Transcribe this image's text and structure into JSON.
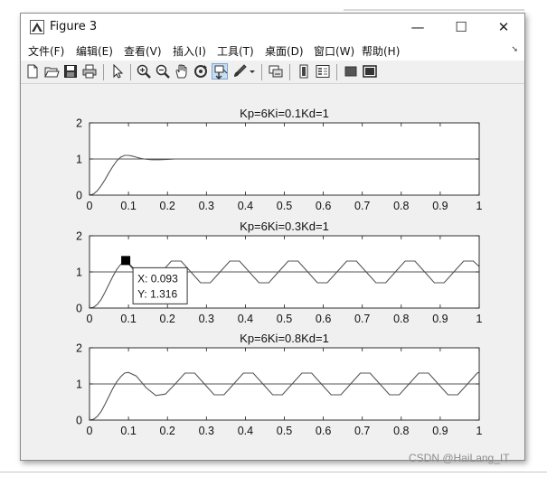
{
  "window": {
    "title": "Figure 3",
    "controls": {
      "minimize": "—",
      "maximize": "☐",
      "close": "✕"
    }
  },
  "menu": [
    "文件(F)",
    "编辑(E)",
    "查看(V)",
    "插入(I)",
    "工具(T)",
    "桌面(D)",
    "窗口(W)",
    "帮助(H)"
  ],
  "toolbar": [
    "new-figure-icon",
    "open-icon",
    "save-icon",
    "print-icon",
    "pointer-icon",
    "zoom-in-icon",
    "zoom-out-icon",
    "pan-icon",
    "rotate-icon",
    "data-cursor-icon",
    "brush-icon",
    "link-plot-icon",
    "colorbar-icon",
    "legend-icon",
    "hide-tools-icon",
    "show-tools-icon"
  ],
  "colors": {
    "curve": "#555555",
    "axes_border": "#1a1a1a",
    "window_bg": "#f0f0f0"
  },
  "chart_data": [
    {
      "type": "line",
      "title": "Kp=6Ki=0.1Kd=1",
      "xlim": [
        0,
        1
      ],
      "ylim": [
        0,
        2
      ],
      "xticks": [
        0,
        0.1,
        0.2,
        0.3,
        0.4,
        0.5,
        0.6,
        0.7,
        0.8,
        0.9,
        1
      ],
      "yticks": [
        0,
        1,
        2
      ],
      "x": [
        0,
        0.01,
        0.02,
        0.03,
        0.04,
        0.05,
        0.06,
        0.07,
        0.08,
        0.09,
        0.1,
        0.11,
        0.12,
        0.13,
        0.14,
        0.15,
        0.16,
        0.18,
        0.2,
        0.22,
        0.24,
        0.26,
        0.3,
        0.35,
        0.4,
        0.5,
        0.6,
        0.7,
        0.8,
        0.9,
        1.0
      ],
      "series": [
        {
          "values": [
            0,
            0.03,
            0.12,
            0.26,
            0.43,
            0.62,
            0.8,
            0.95,
            1.05,
            1.1,
            1.1,
            1.08,
            1.05,
            1.02,
            1.0,
            0.99,
            0.98,
            0.98,
            0.99,
            1.0,
            1.0,
            1.0,
            1.0,
            1.0,
            1.0,
            1.0,
            1.0,
            1.0,
            1.0,
            1.0,
            1.0
          ]
        },
        {
          "values": [
            1,
            1,
            1,
            1,
            1,
            1,
            1,
            1,
            1,
            1,
            1,
            1,
            1,
            1,
            1,
            1,
            1,
            1,
            1,
            1,
            1,
            1,
            1,
            1,
            1,
            1,
            1,
            1,
            1,
            1,
            1
          ]
        }
      ]
    },
    {
      "type": "line",
      "title": "Kp=6Ki=0.3Kd=1",
      "xlim": [
        0,
        1
      ],
      "ylim": [
        0,
        2
      ],
      "xticks": [
        0,
        0.1,
        0.2,
        0.3,
        0.4,
        0.5,
        0.6,
        0.7,
        0.8,
        0.9,
        1
      ],
      "yticks": [
        0,
        1,
        2
      ],
      "x": [
        0,
        0.01,
        0.02,
        0.03,
        0.04,
        0.05,
        0.06,
        0.07,
        0.08,
        0.093,
        0.11,
        0.135,
        0.16,
        0.185,
        0.21,
        0.235,
        0.26,
        0.285,
        0.31,
        0.335,
        0.36,
        0.385,
        0.41,
        0.435,
        0.46,
        0.485,
        0.51,
        0.535,
        0.56,
        0.585,
        0.61,
        0.635,
        0.66,
        0.685,
        0.71,
        0.735,
        0.76,
        0.785,
        0.81,
        0.835,
        0.86,
        0.885,
        0.91,
        0.935,
        0.96,
        0.985,
        1.0
      ],
      "series": [
        {
          "values": [
            0,
            0.02,
            0.1,
            0.24,
            0.44,
            0.66,
            0.88,
            1.07,
            1.21,
            1.316,
            1.1,
            0.75,
            0.7,
            1.0,
            1.3,
            1.3,
            1.0,
            0.7,
            0.7,
            1.0,
            1.3,
            1.3,
            1.0,
            0.7,
            0.7,
            1.0,
            1.3,
            1.3,
            1.0,
            0.7,
            0.7,
            1.0,
            1.3,
            1.3,
            1.0,
            0.7,
            0.7,
            1.0,
            1.3,
            1.3,
            1.0,
            0.7,
            0.7,
            1.0,
            1.3,
            1.3,
            1.15
          ]
        },
        {
          "values": [
            1,
            1,
            1,
            1,
            1,
            1,
            1,
            1,
            1,
            1,
            1,
            1,
            1,
            1,
            1,
            1,
            1,
            1,
            1,
            1,
            1,
            1,
            1,
            1,
            1,
            1,
            1,
            1,
            1,
            1,
            1,
            1,
            1,
            1,
            1,
            1,
            1,
            1,
            1,
            1,
            1,
            1,
            1,
            1,
            1,
            1,
            1
          ]
        }
      ],
      "datatip": {
        "x": 0.093,
        "y": 1.316,
        "xlabel": "X: 0.093",
        "ylabel": "Y: 1.316"
      }
    },
    {
      "type": "line",
      "title": "Kp=6Ki=0.8Kd=1",
      "xlim": [
        0,
        1
      ],
      "ylim": [
        0,
        2
      ],
      "xticks": [
        0,
        0.1,
        0.2,
        0.3,
        0.4,
        0.5,
        0.6,
        0.7,
        0.8,
        0.9,
        1
      ],
      "yticks": [
        0,
        1,
        2
      ],
      "x": [
        0,
        0.01,
        0.02,
        0.03,
        0.04,
        0.05,
        0.06,
        0.07,
        0.08,
        0.09,
        0.1,
        0.12,
        0.145,
        0.17,
        0.195,
        0.22,
        0.245,
        0.27,
        0.295,
        0.32,
        0.345,
        0.37,
        0.395,
        0.42,
        0.445,
        0.47,
        0.495,
        0.52,
        0.545,
        0.57,
        0.595,
        0.62,
        0.645,
        0.67,
        0.695,
        0.72,
        0.745,
        0.77,
        0.795,
        0.82,
        0.845,
        0.87,
        0.895,
        0.92,
        0.945,
        0.97,
        0.995,
        1.0
      ],
      "series": [
        {
          "values": [
            0,
            0.02,
            0.1,
            0.24,
            0.44,
            0.66,
            0.88,
            1.06,
            1.2,
            1.3,
            1.32,
            1.22,
            0.9,
            0.68,
            0.72,
            1.0,
            1.3,
            1.3,
            1.0,
            0.7,
            0.7,
            1.0,
            1.3,
            1.3,
            1.0,
            0.7,
            0.7,
            1.0,
            1.3,
            1.3,
            1.0,
            0.7,
            0.7,
            1.0,
            1.3,
            1.3,
            1.0,
            0.7,
            0.7,
            1.0,
            1.3,
            1.3,
            1.0,
            0.7,
            0.7,
            1.0,
            1.3,
            1.32
          ]
        },
        {
          "values": [
            1,
            1,
            1,
            1,
            1,
            1,
            1,
            1,
            1,
            1,
            1,
            1,
            1,
            1,
            1,
            1,
            1,
            1,
            1,
            1,
            1,
            1,
            1,
            1,
            1,
            1,
            1,
            1,
            1,
            1,
            1,
            1,
            1,
            1,
            1,
            1,
            1,
            1,
            1,
            1,
            1,
            1,
            1,
            1,
            1,
            1,
            1,
            1
          ]
        }
      ]
    }
  ],
  "watermark": "CSDN @HaiLang_IT"
}
